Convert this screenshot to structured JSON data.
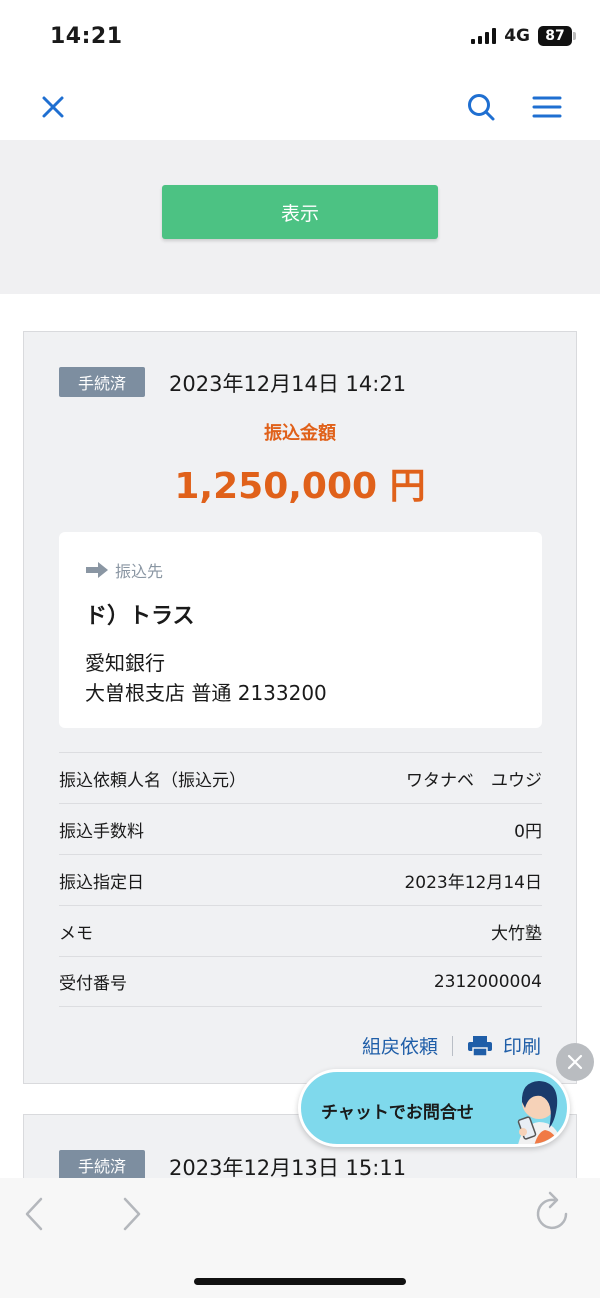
{
  "status_bar": {
    "time": "14:21",
    "network": "4G",
    "battery": "87"
  },
  "nav": {
    "close_icon": "close-icon",
    "search_icon": "search-icon",
    "menu_icon": "menu-icon"
  },
  "filter": {
    "show_label": "表示"
  },
  "transfers": [
    {
      "status": "手続済",
      "datetime": "2023年12月14日 14:21",
      "amount_label": "振込金額",
      "amount": "1,250,000 円",
      "destination": {
        "heading": "振込先",
        "name": "ド）トラス",
        "bank": "愛知銀行",
        "branch_account": "大曽根支店 普通 2133200"
      },
      "details": [
        {
          "label": "振込依頼人名（振込元）",
          "value": "ワタナベ　ユウジ"
        },
        {
          "label": "振込手数料",
          "value": "0円"
        },
        {
          "label": "振込指定日",
          "value": "2023年12月14日"
        },
        {
          "label": "メモ",
          "value": "大竹塾"
        },
        {
          "label": "受付番号",
          "value": "2312000004"
        }
      ],
      "actions": {
        "cancel_label": "組戻依頼",
        "print_label": "印刷"
      }
    },
    {
      "status": "手続済",
      "datetime": "2023年12月13日 15:11"
    }
  ],
  "chat": {
    "label": "チャットでお問合せ"
  },
  "colors": {
    "accent_green": "#4cc283",
    "amount_orange": "#e0611a",
    "link_blue": "#1f5ea8",
    "badge_gray": "#7d8ea0"
  }
}
